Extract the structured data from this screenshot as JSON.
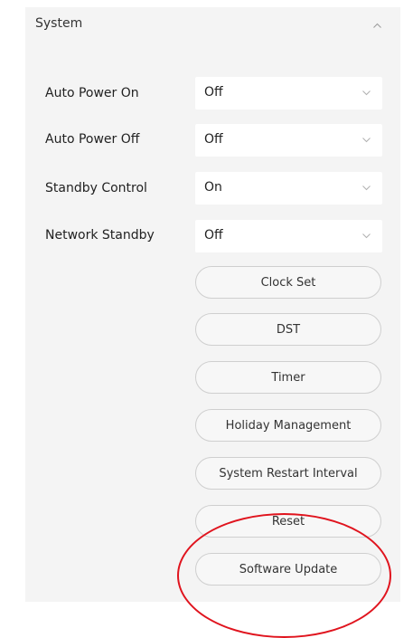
{
  "section": {
    "title": "System",
    "collapse_icon": "chevron-up-icon"
  },
  "settings": [
    {
      "label": "Auto Power On",
      "value": "Off"
    },
    {
      "label": "Auto Power Off",
      "value": "Off"
    },
    {
      "label": "Standby Control",
      "value": "On"
    },
    {
      "label": "Network Standby",
      "value": "Off"
    }
  ],
  "buttons": {
    "clock_set": "Clock Set",
    "dst": "DST",
    "timer": "Timer",
    "holiday_management": "Holiday Management",
    "system_restart_interval": "System Restart Interval",
    "reset": "Reset",
    "software_update": "Software Update"
  },
  "colors": {
    "panel_bg": "#f4f4f4",
    "button_border": "#cfcfcf",
    "annotation_circle": "#e0141e"
  }
}
